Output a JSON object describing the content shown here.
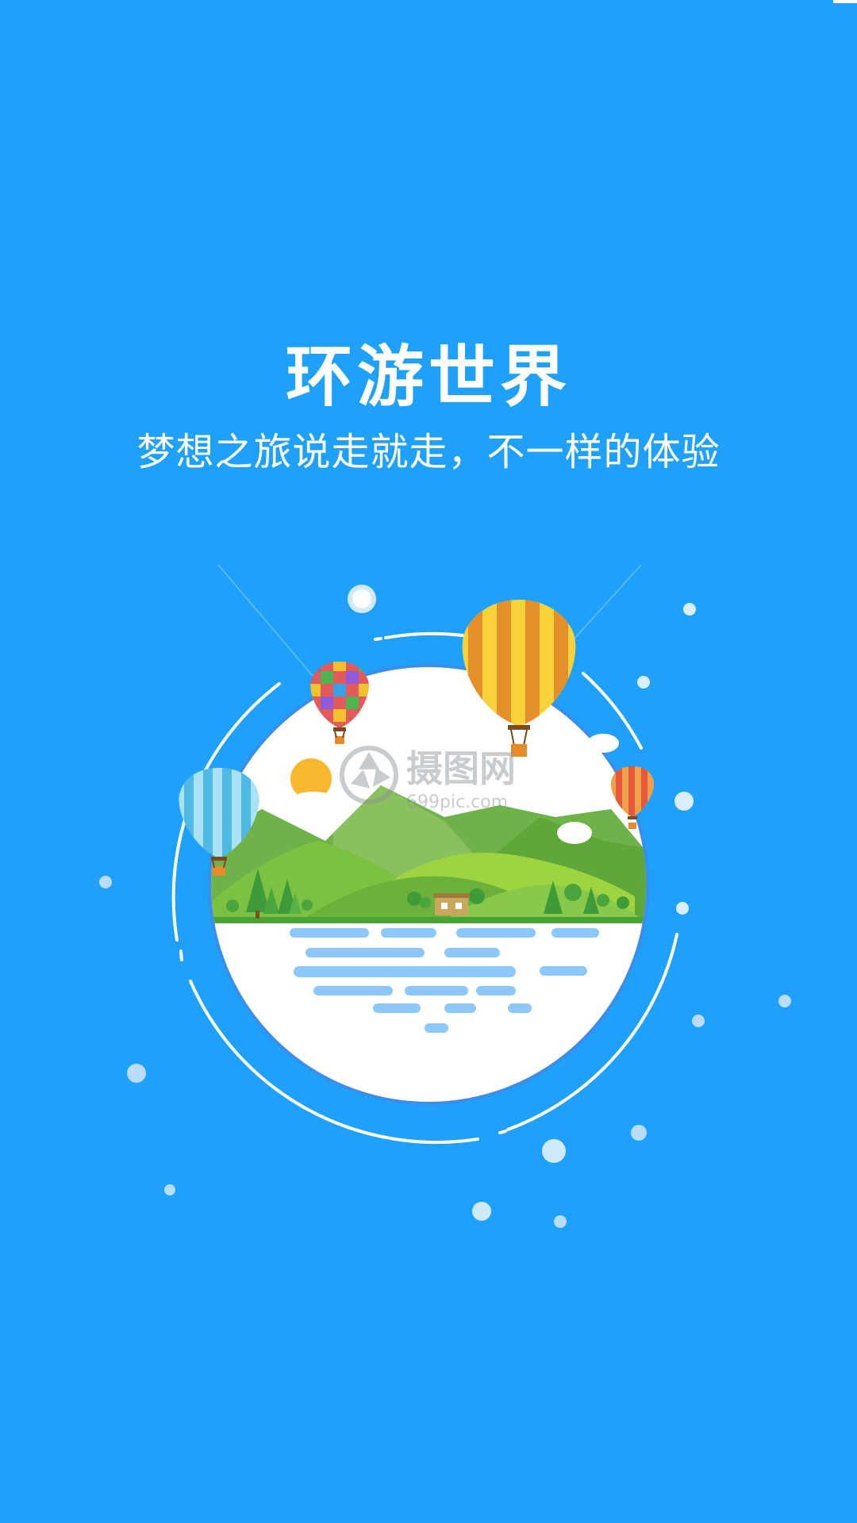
{
  "splash": {
    "title": "环游世界",
    "subtitle": "梦想之旅说走就走，不一样的体验"
  },
  "watermark": {
    "brand": "摄图网",
    "url": "699pic.com"
  },
  "colors": {
    "background": "#1fa1fb",
    "text": "#ffffff",
    "circle_fill": "#ffffff",
    "circle_border": "#3a8de8",
    "hill_dark": "#5ea83a",
    "hill_light": "#9ed43f",
    "water": "#8cc8fb",
    "balloon_yellow": "#f2c12e",
    "balloon_orange": "#e98a2a",
    "balloon_blue": "#5cc3e8",
    "sun": "#f7b731"
  },
  "icons": [
    "balloon-icon",
    "sun-icon",
    "cloud-icon",
    "tree-icon",
    "house-icon"
  ]
}
